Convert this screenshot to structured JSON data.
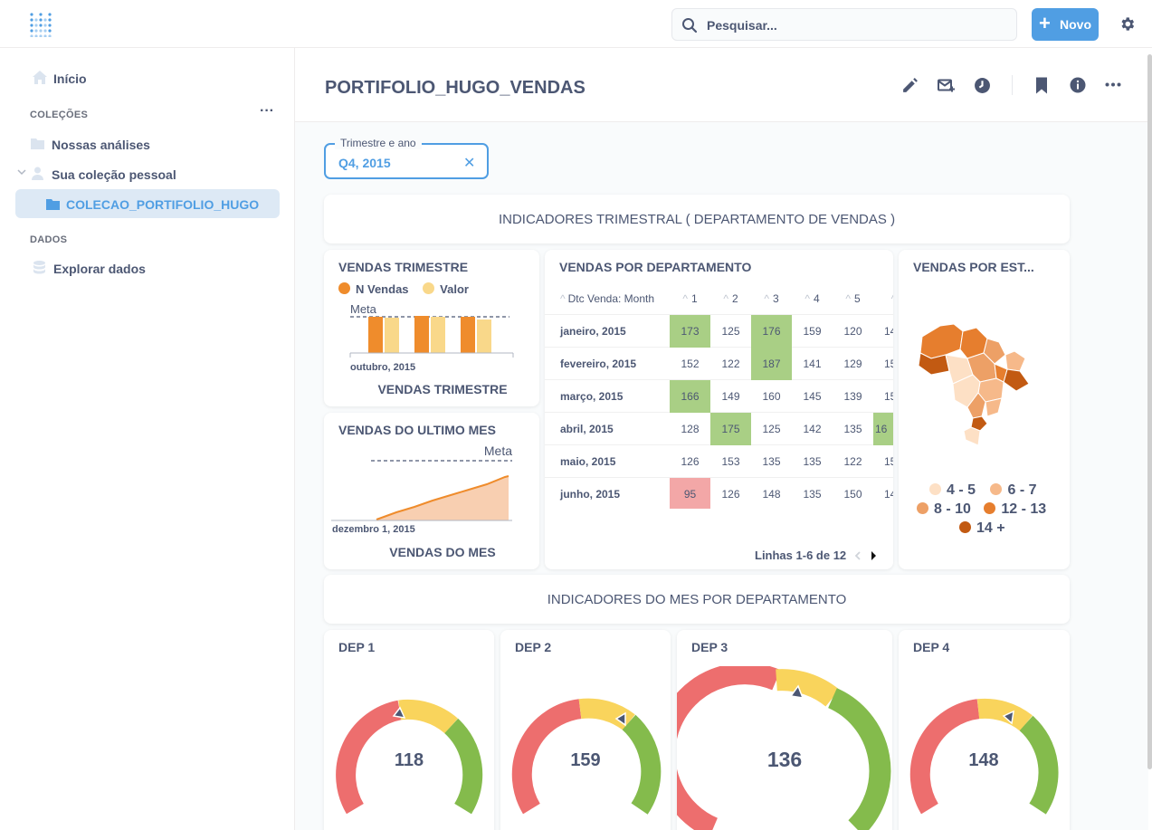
{
  "topbar": {
    "search_placeholder": "Pesquisar...",
    "new_label": "Novo"
  },
  "sidebar": {
    "home": "Início",
    "collections_header": "COLEÇÕES",
    "collections_more": "···",
    "items": [
      {
        "label": "Nossas análises"
      },
      {
        "label": "Sua coleção pessoal"
      },
      {
        "label": "COLECAO_PORTIFOLIO_HUGO"
      }
    ],
    "data_header": "DADOS",
    "explore": "Explorar dados"
  },
  "dashboard": {
    "title": "PORTIFOLIO_HUGO_VENDAS",
    "filter_label": "Trimestre e ano",
    "filter_value": "Q4, 2015",
    "section1": "INDICADORES TRIMESTRAL ( DEPARTAMENTO DE VENDAS )",
    "section2": "INDICADORES DO MES POR DEPARTAMENTO"
  },
  "cards": {
    "vendas_trimestre": {
      "title": "VENDAS TRIMESTRE",
      "legend": [
        "N Vendas",
        "Valor"
      ],
      "meta_label": "Meta",
      "x_label": "outubro, 2015",
      "footer": "VENDAS TRIMESTRE"
    },
    "vendas_ultimo_mes": {
      "title": "VENDAS DO ULTIMO MES",
      "meta_label": "Meta",
      "x_label": "dezembro 1, 2015",
      "footer": "VENDAS DO MES"
    },
    "vendas_departamento": {
      "title": "VENDAS POR DEPARTAMENTO",
      "col_header": "Dtc Venda: Month",
      "columns": [
        "1",
        "2",
        "3",
        "4",
        "5"
      ],
      "rows": [
        {
          "label": "janeiro, 2015",
          "values": [
            "173",
            "125",
            "176",
            "159",
            "120",
            "14"
          ]
        },
        {
          "label": "fevereiro, 2015",
          "values": [
            "152",
            "122",
            "187",
            "141",
            "129",
            "15"
          ]
        },
        {
          "label": "março, 2015",
          "values": [
            "166",
            "149",
            "160",
            "145",
            "139",
            "15"
          ]
        },
        {
          "label": "abril, 2015",
          "values": [
            "128",
            "175",
            "125",
            "142",
            "135",
            "16"
          ]
        },
        {
          "label": "maio, 2015",
          "values": [
            "126",
            "153",
            "135",
            "135",
            "122",
            "15"
          ]
        },
        {
          "label": "junho, 2015",
          "values": [
            "95",
            "126",
            "148",
            "135",
            "150",
            "14"
          ]
        }
      ],
      "pager": "Linhas 1-6 de 12"
    },
    "vendas_estado": {
      "title": "VENDAS POR EST...",
      "legend": [
        "4 - 5",
        "6 - 7",
        "8 - 10",
        "12 - 13",
        "14 +"
      ],
      "legend_colors": [
        "#fde0c5",
        "#f6b98a",
        "#eda066",
        "#e67e2e",
        "#c25a12"
      ]
    },
    "gauges": [
      {
        "title": "DEP 1",
        "value": "118"
      },
      {
        "title": "DEP 2",
        "value": "159"
      },
      {
        "title": "DEP 3",
        "value": "136"
      },
      {
        "title": "DEP 4",
        "value": "148"
      }
    ]
  },
  "colors": {
    "accent": "#509ee3",
    "green": "#84bb4c",
    "red": "#ed6e6e",
    "yellow": "#f9d45c",
    "orange": "#ef8c2c",
    "cell_green": "#a9cf85",
    "cell_red": "#f3a7a7"
  }
}
